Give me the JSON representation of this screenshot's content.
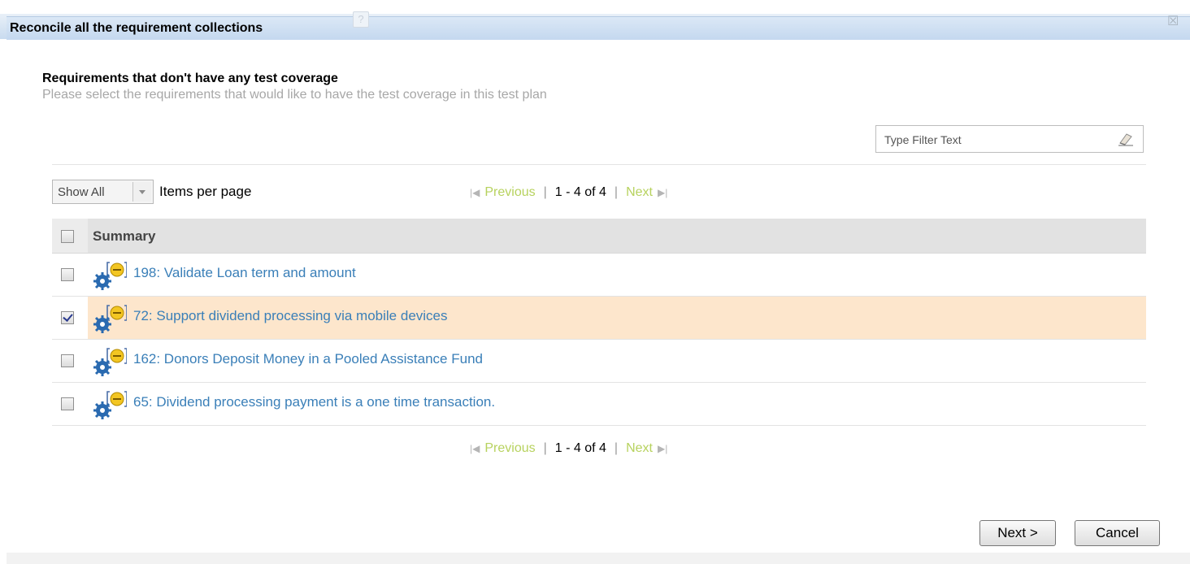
{
  "dialog": {
    "title": "Reconcile all the requirement collections",
    "help_glyph": "?",
    "close_glyph": "☒"
  },
  "section": {
    "heading": "Requirements that don't have any test coverage",
    "subheading": "Please select the requirements that would like to have the test coverage in this test plan"
  },
  "filter": {
    "placeholder": "Type Filter Text",
    "icon": "eraser-icon"
  },
  "paging": {
    "per_page_value": "Show All",
    "per_page_label": "Items per page",
    "previous": "Previous",
    "next": "Next",
    "range": "1 - 4 of 4",
    "separator": "|"
  },
  "table": {
    "header": "Summary",
    "rows": [
      {
        "label": "198: Validate Loan term and amount",
        "checked": false
      },
      {
        "label": "72: Support dividend processing via mobile devices",
        "checked": true
      },
      {
        "label": "162: Donors Deposit Money in a Pooled Assistance Fund",
        "checked": false
      },
      {
        "label": "65: Dividend processing payment is a one time transaction.",
        "checked": false
      }
    ]
  },
  "buttons": {
    "next": "Next >",
    "cancel": "Cancel"
  },
  "colors": {
    "accent_link": "#3a7fb8",
    "selected_row": "#fde6cc",
    "pager_nav": "#b7d25e",
    "titlebar": "#c9dbef"
  }
}
